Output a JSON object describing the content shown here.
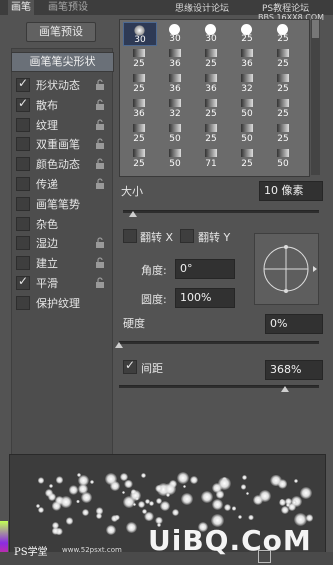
{
  "tabs": [
    {
      "label": "画笔"
    },
    {
      "label": "画笔预设"
    }
  ],
  "watermark": {
    "line1": "思缘设计论坛",
    "line2": "PS教程论坛",
    "line3": "BBS.16XX8.COM"
  },
  "left": {
    "presets_button": "画笔预设",
    "tip_shape_button": "画笔笔尖形状",
    "items": [
      {
        "label": "形状动态",
        "checked": true
      },
      {
        "label": "散布",
        "checked": true
      },
      {
        "label": "纹理",
        "checked": false
      },
      {
        "label": "双重画笔",
        "checked": false
      },
      {
        "label": "颜色动态",
        "checked": false
      },
      {
        "label": "传递",
        "checked": false
      },
      {
        "label": "画笔笔势",
        "checked": false
      },
      {
        "label": "杂色",
        "checked": false
      },
      {
        "label": "湿边",
        "checked": false
      },
      {
        "label": "建立",
        "checked": false
      },
      {
        "label": "平滑",
        "checked": true
      },
      {
        "label": "保护纹理",
        "checked": false
      }
    ]
  },
  "brush_grid": [
    [
      "30",
      "30",
      "30",
      "25",
      "25"
    ],
    [
      "25",
      "36",
      "25",
      "36",
      "25"
    ],
    [
      "25",
      "36",
      "36",
      "32",
      "25"
    ],
    [
      "36",
      "32",
      "25",
      "50",
      "25"
    ],
    [
      "25",
      "50",
      "25",
      "50",
      "25"
    ],
    [
      "25",
      "50",
      "71",
      "25",
      "50"
    ]
  ],
  "size": {
    "label": "大小",
    "value": "10 像素",
    "fraction": 0.05
  },
  "flip": {
    "x_label": "翻转 X",
    "y_label": "翻转 Y"
  },
  "angle": {
    "label": "角度:",
    "value": "0°"
  },
  "roundness": {
    "label": "圆度:",
    "value": "100%"
  },
  "hardness": {
    "label": "硬度",
    "value": "0%",
    "fraction": 0.0
  },
  "spacing": {
    "label": "间距",
    "value": "368%",
    "checked": true,
    "fraction": 0.83
  },
  "bottom": {
    "left_logo": "PS学堂",
    "left_url": "www.52psxt.com",
    "right_logo": "UiBQ.CoM"
  }
}
